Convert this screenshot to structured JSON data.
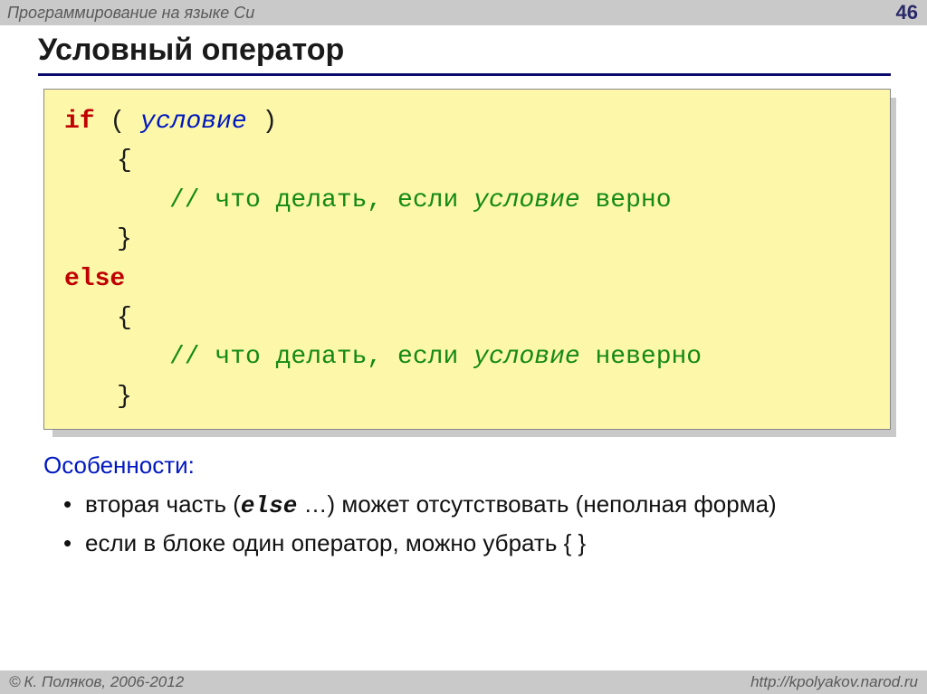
{
  "header": {
    "subject": "Программирование на языке Си",
    "page": "46"
  },
  "title": "Условный оператор",
  "code": {
    "kw_if": "if",
    "paren_open": " ( ",
    "condition": "условие",
    "paren_close": " ) ",
    "brace_open": "{",
    "comment_prefix": "// что делать, если ",
    "cond_word": "условие",
    "true_suffix": " верно",
    "brace_close": "}",
    "kw_else": "else",
    "false_suffix": " неверно"
  },
  "notes": {
    "heading": "Особенности:",
    "item1_a": "вторая часть (",
    "item1_else": "else",
    "item1_b": " …) может отсутствовать (неполная форма)",
    "item2": "если в блоке один оператор, можно убрать { }"
  },
  "footer": {
    "copyright": "К. Поляков, 2006-2012",
    "url": "http://kpolyakov.narod.ru"
  }
}
